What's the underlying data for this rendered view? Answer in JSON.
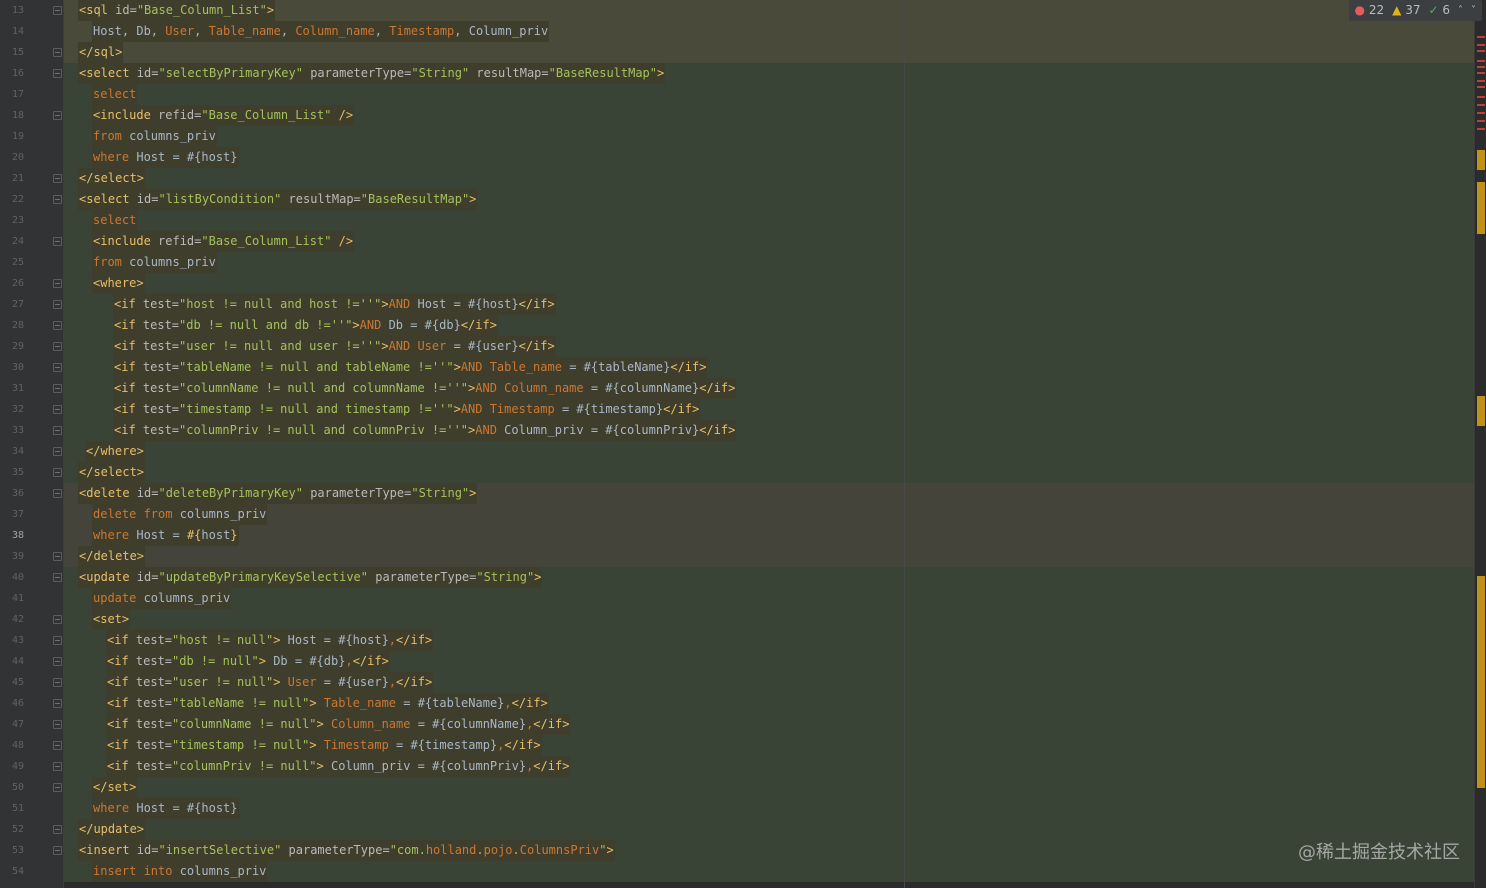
{
  "editor": {
    "current_line": "38",
    "inspection": {
      "errors": "22",
      "warnings": "37",
      "weak_warnings": "6",
      "up_arrow": "˄",
      "down_arrow": "˅"
    },
    "watermark": "@稀土掘金技术社区",
    "lines": [
      {
        "n": "13",
        "band": "sql",
        "indent": 0,
        "tokens": [
          [
            "t",
            "<sql "
          ],
          [
            "a",
            "id="
          ],
          [
            "v",
            "\"Base_Column_List\""
          ],
          [
            "t",
            ">"
          ]
        ]
      },
      {
        "n": "14",
        "band": "sql",
        "indent": 2,
        "tokens": [
          [
            "p",
            "Host, Db, "
          ],
          [
            "k",
            "User"
          ],
          [
            "p",
            ", "
          ],
          [
            "k",
            "Table_name"
          ],
          [
            "p",
            ", "
          ],
          [
            "k",
            "Column_name"
          ],
          [
            "p",
            ", "
          ],
          [
            "k",
            "Timestamp"
          ],
          [
            "p",
            ", Column_priv"
          ]
        ]
      },
      {
        "n": "15",
        "band": "sql",
        "indent": 0,
        "tokens": [
          [
            "t",
            "</sql>"
          ]
        ]
      },
      {
        "n": "16",
        "band": "select",
        "indent": 0,
        "tokens": [
          [
            "t",
            "<select "
          ],
          [
            "a",
            "id="
          ],
          [
            "v",
            "\"selectByPrimaryKey\""
          ],
          [
            "a",
            " parameterType="
          ],
          [
            "v",
            "\"String\""
          ],
          [
            "a",
            " resultMap="
          ],
          [
            "v",
            "\"BaseResultMap\""
          ],
          [
            "t",
            ">"
          ]
        ]
      },
      {
        "n": "17",
        "band": "select",
        "indent": 2,
        "tokens": [
          [
            "k",
            "select"
          ]
        ]
      },
      {
        "n": "18",
        "band": "select",
        "indent": 2,
        "tokens": [
          [
            "t",
            "<include "
          ],
          [
            "a",
            "refid="
          ],
          [
            "v",
            "\"Base_Column_List\""
          ],
          [
            "t",
            " />"
          ]
        ]
      },
      {
        "n": "19",
        "band": "select",
        "indent": 2,
        "tokens": [
          [
            "k",
            "from "
          ],
          [
            "p",
            "columns_priv"
          ]
        ]
      },
      {
        "n": "20",
        "band": "select",
        "indent": 2,
        "tokens": [
          [
            "k",
            "where "
          ],
          [
            "p",
            "Host = #{host}"
          ]
        ]
      },
      {
        "n": "21",
        "band": "select",
        "indent": 0,
        "tokens": [
          [
            "t",
            "</select>"
          ]
        ]
      },
      {
        "n": "22",
        "band": "select",
        "indent": 0,
        "tokens": [
          [
            "t",
            "<select "
          ],
          [
            "a",
            "id="
          ],
          [
            "v",
            "\"listByCondition\""
          ],
          [
            "a",
            " resultMap="
          ],
          [
            "v",
            "\"BaseResultMap\""
          ],
          [
            "t",
            ">"
          ]
        ]
      },
      {
        "n": "23",
        "band": "select",
        "indent": 2,
        "tokens": [
          [
            "k",
            "select"
          ]
        ]
      },
      {
        "n": "24",
        "band": "select",
        "indent": 2,
        "tokens": [
          [
            "t",
            "<include "
          ],
          [
            "a",
            "refid="
          ],
          [
            "v",
            "\"Base_Column_List\""
          ],
          [
            "t",
            " />"
          ]
        ]
      },
      {
        "n": "25",
        "band": "select",
        "indent": 2,
        "tokens": [
          [
            "k",
            "from "
          ],
          [
            "p",
            "columns_priv"
          ]
        ]
      },
      {
        "n": "26",
        "band": "select",
        "indent": 2,
        "tokens": [
          [
            "t",
            "<where>"
          ]
        ]
      },
      {
        "n": "27",
        "band": "select",
        "indent": 5,
        "tokens": [
          [
            "t",
            "<if "
          ],
          [
            "a",
            "test="
          ],
          [
            "v",
            "\"host != null and host !=''\""
          ],
          [
            "t",
            ">"
          ],
          [
            "k",
            "AND "
          ],
          [
            "p",
            "Host = #{host}"
          ],
          [
            "t",
            "</if>"
          ]
        ]
      },
      {
        "n": "28",
        "band": "select",
        "indent": 5,
        "tokens": [
          [
            "t",
            "<if "
          ],
          [
            "a",
            "test="
          ],
          [
            "v",
            "\"db != null and db !=''\""
          ],
          [
            "t",
            ">"
          ],
          [
            "k",
            "AND "
          ],
          [
            "p",
            "Db = #{db}"
          ],
          [
            "t",
            "</if>"
          ]
        ]
      },
      {
        "n": "29",
        "band": "select",
        "indent": 5,
        "tokens": [
          [
            "t",
            "<if "
          ],
          [
            "a",
            "test="
          ],
          [
            "v",
            "\"user != null and user !=''\""
          ],
          [
            "t",
            ">"
          ],
          [
            "k",
            "AND User "
          ],
          [
            "p",
            "= #{user}"
          ],
          [
            "t",
            "</if>"
          ]
        ]
      },
      {
        "n": "30",
        "band": "select",
        "indent": 5,
        "tokens": [
          [
            "t",
            "<if "
          ],
          [
            "a",
            "test="
          ],
          [
            "v",
            "\"tableName != null and tableName !=''\""
          ],
          [
            "t",
            ">"
          ],
          [
            "k",
            "AND Table_name "
          ],
          [
            "p",
            "= #{tableName}"
          ],
          [
            "t",
            "</if>"
          ]
        ]
      },
      {
        "n": "31",
        "band": "select",
        "indent": 5,
        "tokens": [
          [
            "t",
            "<if "
          ],
          [
            "a",
            "test="
          ],
          [
            "v",
            "\"columnName != null and columnName !=''\""
          ],
          [
            "t",
            ">"
          ],
          [
            "k",
            "AND Column_name "
          ],
          [
            "p",
            "= #{columnName}"
          ],
          [
            "t",
            "</if>"
          ]
        ]
      },
      {
        "n": "32",
        "band": "select",
        "indent": 5,
        "tokens": [
          [
            "t",
            "<if "
          ],
          [
            "a",
            "test="
          ],
          [
            "v",
            "\"timestamp != null and timestamp !=''\""
          ],
          [
            "t",
            ">"
          ],
          [
            "k",
            "AND Timestamp "
          ],
          [
            "p",
            "= #{timestamp}"
          ],
          [
            "t",
            "</if>"
          ]
        ]
      },
      {
        "n": "33",
        "band": "select",
        "indent": 5,
        "tokens": [
          [
            "t",
            "<if "
          ],
          [
            "a",
            "test="
          ],
          [
            "v",
            "\"columnPriv != null and columnPriv !=''\""
          ],
          [
            "t",
            ">"
          ],
          [
            "k",
            "AND "
          ],
          [
            "p",
            "Column_priv = #{columnPriv}"
          ],
          [
            "t",
            "</if>"
          ]
        ]
      },
      {
        "n": "34",
        "band": "select",
        "indent": 1,
        "tokens": [
          [
            "t",
            "</where>"
          ]
        ]
      },
      {
        "n": "35",
        "band": "select",
        "indent": 0,
        "tokens": [
          [
            "t",
            "</select>"
          ]
        ]
      },
      {
        "n": "36",
        "band": "delete",
        "indent": 0,
        "tokens": [
          [
            "t",
            "<delete "
          ],
          [
            "a",
            "id="
          ],
          [
            "v",
            "\"deleteByPrimaryKey\""
          ],
          [
            "a",
            " parameterType="
          ],
          [
            "v",
            "\"String\""
          ],
          [
            "t",
            ">"
          ]
        ]
      },
      {
        "n": "37",
        "band": "delete",
        "indent": 2,
        "tokens": [
          [
            "k",
            "delete from "
          ],
          [
            "p",
            "columns_priv"
          ]
        ]
      },
      {
        "n": "38",
        "band": "delete",
        "indent": 2,
        "tokens": [
          [
            "k",
            "where "
          ],
          [
            "p",
            "Host = "
          ],
          [
            "t",
            "#{"
          ],
          [
            "p",
            "host"
          ],
          [
            "t",
            "}"
          ]
        ]
      },
      {
        "n": "39",
        "band": "delete",
        "indent": 0,
        "tokens": [
          [
            "t",
            "</delete>"
          ]
        ]
      },
      {
        "n": "40",
        "band": "update",
        "indent": 0,
        "tokens": [
          [
            "t",
            "<update "
          ],
          [
            "a",
            "id="
          ],
          [
            "v",
            "\"updateByPrimaryKeySelective\""
          ],
          [
            "a",
            " parameterType="
          ],
          [
            "v",
            "\"String\""
          ],
          [
            "t",
            ">"
          ]
        ]
      },
      {
        "n": "41",
        "band": "update",
        "indent": 2,
        "tokens": [
          [
            "k",
            "update "
          ],
          [
            "p",
            "columns_priv"
          ]
        ]
      },
      {
        "n": "42",
        "band": "update",
        "indent": 2,
        "tokens": [
          [
            "t",
            "<set>"
          ]
        ]
      },
      {
        "n": "43",
        "band": "update",
        "indent": 4,
        "tokens": [
          [
            "t",
            "<if "
          ],
          [
            "a",
            "test="
          ],
          [
            "v",
            "\"host != null\""
          ],
          [
            "t",
            ">"
          ],
          [
            "p",
            " Host = #{host}"
          ],
          [
            "k",
            ","
          ],
          [
            "t",
            "</if>"
          ]
        ]
      },
      {
        "n": "44",
        "band": "update",
        "indent": 4,
        "tokens": [
          [
            "t",
            "<if "
          ],
          [
            "a",
            "test="
          ],
          [
            "v",
            "\"db != null\""
          ],
          [
            "t",
            ">"
          ],
          [
            "p",
            " Db = #{db}"
          ],
          [
            "k",
            ","
          ],
          [
            "t",
            "</if>"
          ]
        ]
      },
      {
        "n": "45",
        "band": "update",
        "indent": 4,
        "tokens": [
          [
            "t",
            "<if "
          ],
          [
            "a",
            "test="
          ],
          [
            "v",
            "\"user != null\""
          ],
          [
            "t",
            ">"
          ],
          [
            "k",
            " User "
          ],
          [
            "p",
            "= #{user}"
          ],
          [
            "k",
            ","
          ],
          [
            "t",
            "</if>"
          ]
        ]
      },
      {
        "n": "46",
        "band": "update",
        "indent": 4,
        "tokens": [
          [
            "t",
            "<if "
          ],
          [
            "a",
            "test="
          ],
          [
            "v",
            "\"tableName != null\""
          ],
          [
            "t",
            ">"
          ],
          [
            "k",
            " Table_name "
          ],
          [
            "p",
            "= #{tableName}"
          ],
          [
            "k",
            ","
          ],
          [
            "t",
            "</if>"
          ]
        ]
      },
      {
        "n": "47",
        "band": "update",
        "indent": 4,
        "tokens": [
          [
            "t",
            "<if "
          ],
          [
            "a",
            "test="
          ],
          [
            "v",
            "\"columnName != null\""
          ],
          [
            "t",
            ">"
          ],
          [
            "k",
            " Column_name "
          ],
          [
            "p",
            "= #{columnName}"
          ],
          [
            "k",
            ","
          ],
          [
            "t",
            "</if>"
          ]
        ]
      },
      {
        "n": "48",
        "band": "update",
        "indent": 4,
        "tokens": [
          [
            "t",
            "<if "
          ],
          [
            "a",
            "test="
          ],
          [
            "v",
            "\"timestamp != null\""
          ],
          [
            "t",
            ">"
          ],
          [
            "k",
            " Timestamp "
          ],
          [
            "p",
            "= #{timestamp}"
          ],
          [
            "k",
            ","
          ],
          [
            "t",
            "</if>"
          ]
        ]
      },
      {
        "n": "49",
        "band": "update",
        "indent": 4,
        "tokens": [
          [
            "t",
            "<if "
          ],
          [
            "a",
            "test="
          ],
          [
            "v",
            "\"columnPriv != null\""
          ],
          [
            "t",
            ">"
          ],
          [
            "p",
            " Column_priv = #{columnPriv}"
          ],
          [
            "k",
            ","
          ],
          [
            "t",
            "</if>"
          ]
        ]
      },
      {
        "n": "50",
        "band": "update",
        "indent": 2,
        "tokens": [
          [
            "t",
            "</set>"
          ]
        ]
      },
      {
        "n": "51",
        "band": "update",
        "indent": 2,
        "tokens": [
          [
            "k",
            "where "
          ],
          [
            "p",
            "Host = #{host}"
          ]
        ]
      },
      {
        "n": "52",
        "band": "update",
        "indent": 0,
        "tokens": [
          [
            "t",
            "</update>"
          ]
        ]
      },
      {
        "n": "53",
        "band": "select",
        "indent": 0,
        "tokens": [
          [
            "t",
            "<insert "
          ],
          [
            "a",
            "id="
          ],
          [
            "v",
            "\"insertSelective\""
          ],
          [
            "a",
            " parameterType="
          ],
          [
            "v",
            "\"com."
          ],
          [
            "k",
            "holland"
          ],
          [
            "v",
            "."
          ],
          [
            "k",
            "pojo"
          ],
          [
            "v",
            "."
          ],
          [
            "k",
            "ColumnsPriv"
          ],
          [
            "v",
            "\""
          ],
          [
            "t",
            ">"
          ]
        ]
      },
      {
        "n": "54",
        "band": "select",
        "indent": 2,
        "tokens": [
          [
            "k",
            "insert into "
          ],
          [
            "p",
            "columns_priv"
          ]
        ]
      }
    ]
  }
}
